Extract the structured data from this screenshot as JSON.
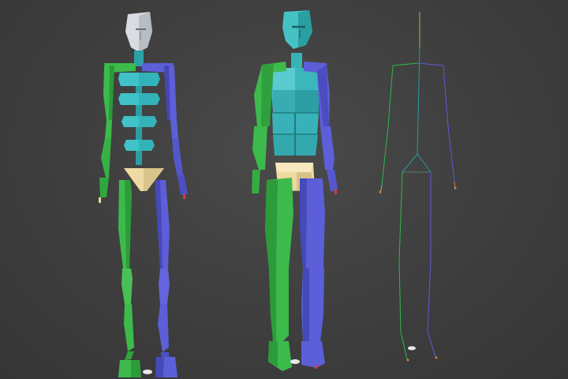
{
  "viewport": {
    "background": "#3d3d3d"
  },
  "figures": [
    {
      "name": "skeleton-figure",
      "style": "segmented biped bones"
    },
    {
      "name": "block-figure",
      "style": "boxy biped mesh"
    },
    {
      "name": "stick-figure",
      "style": "wireframe bone lines"
    }
  ],
  "colors": {
    "left_side": "#2fb84a",
    "right_side": "#5b5bd6",
    "spine": "#33b1b8",
    "head_skeleton": "#d8dde0",
    "head_block": "#3cbcbf",
    "pelvis": "#eed9a0",
    "footstep_marker": "#e8e8e8",
    "hand_tip": "#d04040"
  }
}
